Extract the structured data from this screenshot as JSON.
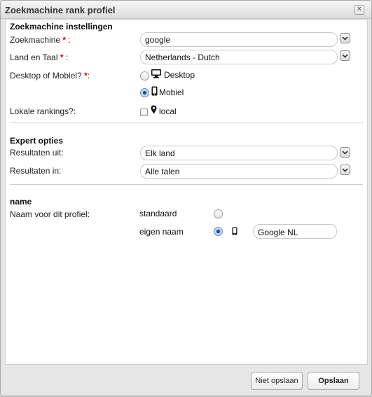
{
  "dialog": {
    "title": "Zoekmachine rank profiel",
    "close_glyph": "✕"
  },
  "search_settings": {
    "heading": "Zoekmachine instellingen",
    "search_engine": {
      "label": "Zoekmachine",
      "required": "*",
      "suffix": " :",
      "value": "google"
    },
    "country_language": {
      "label": "Land en Taal",
      "required": "*",
      "suffix": " :",
      "value": "Netherlands - Dutch"
    },
    "device": {
      "label": "Desktop of Mobiel?",
      "required": "*",
      "suffix": ":",
      "options": [
        {
          "label": "Desktop",
          "icon": "desktop-icon",
          "checked": false
        },
        {
          "label": "Mobiel",
          "icon": "mobile-icon",
          "checked": true
        }
      ]
    },
    "local": {
      "label": "Lokale rankings?:",
      "option_label": "local",
      "icon": "map-pin-icon",
      "checked": false
    }
  },
  "expert_options": {
    "heading": "Expert opties",
    "results_from": {
      "label": "Resultaten uit:",
      "value": "Elk land"
    },
    "results_in": {
      "label": "Resultaten in:",
      "value": "Alle talen"
    }
  },
  "name_section": {
    "heading": "name",
    "label": "Naam voor dit profiel:",
    "options": [
      {
        "label": "standaard",
        "checked": false
      },
      {
        "label": "eigen naam",
        "checked": true
      }
    ],
    "custom_name_value": "Google NL",
    "device_icon": "mobile-icon"
  },
  "footer": {
    "cancel_label": "Niet opslaan",
    "save_label": "Opslaan"
  },
  "colors": {
    "required": "#d40000",
    "radio_checked": "#2a4f8f"
  }
}
